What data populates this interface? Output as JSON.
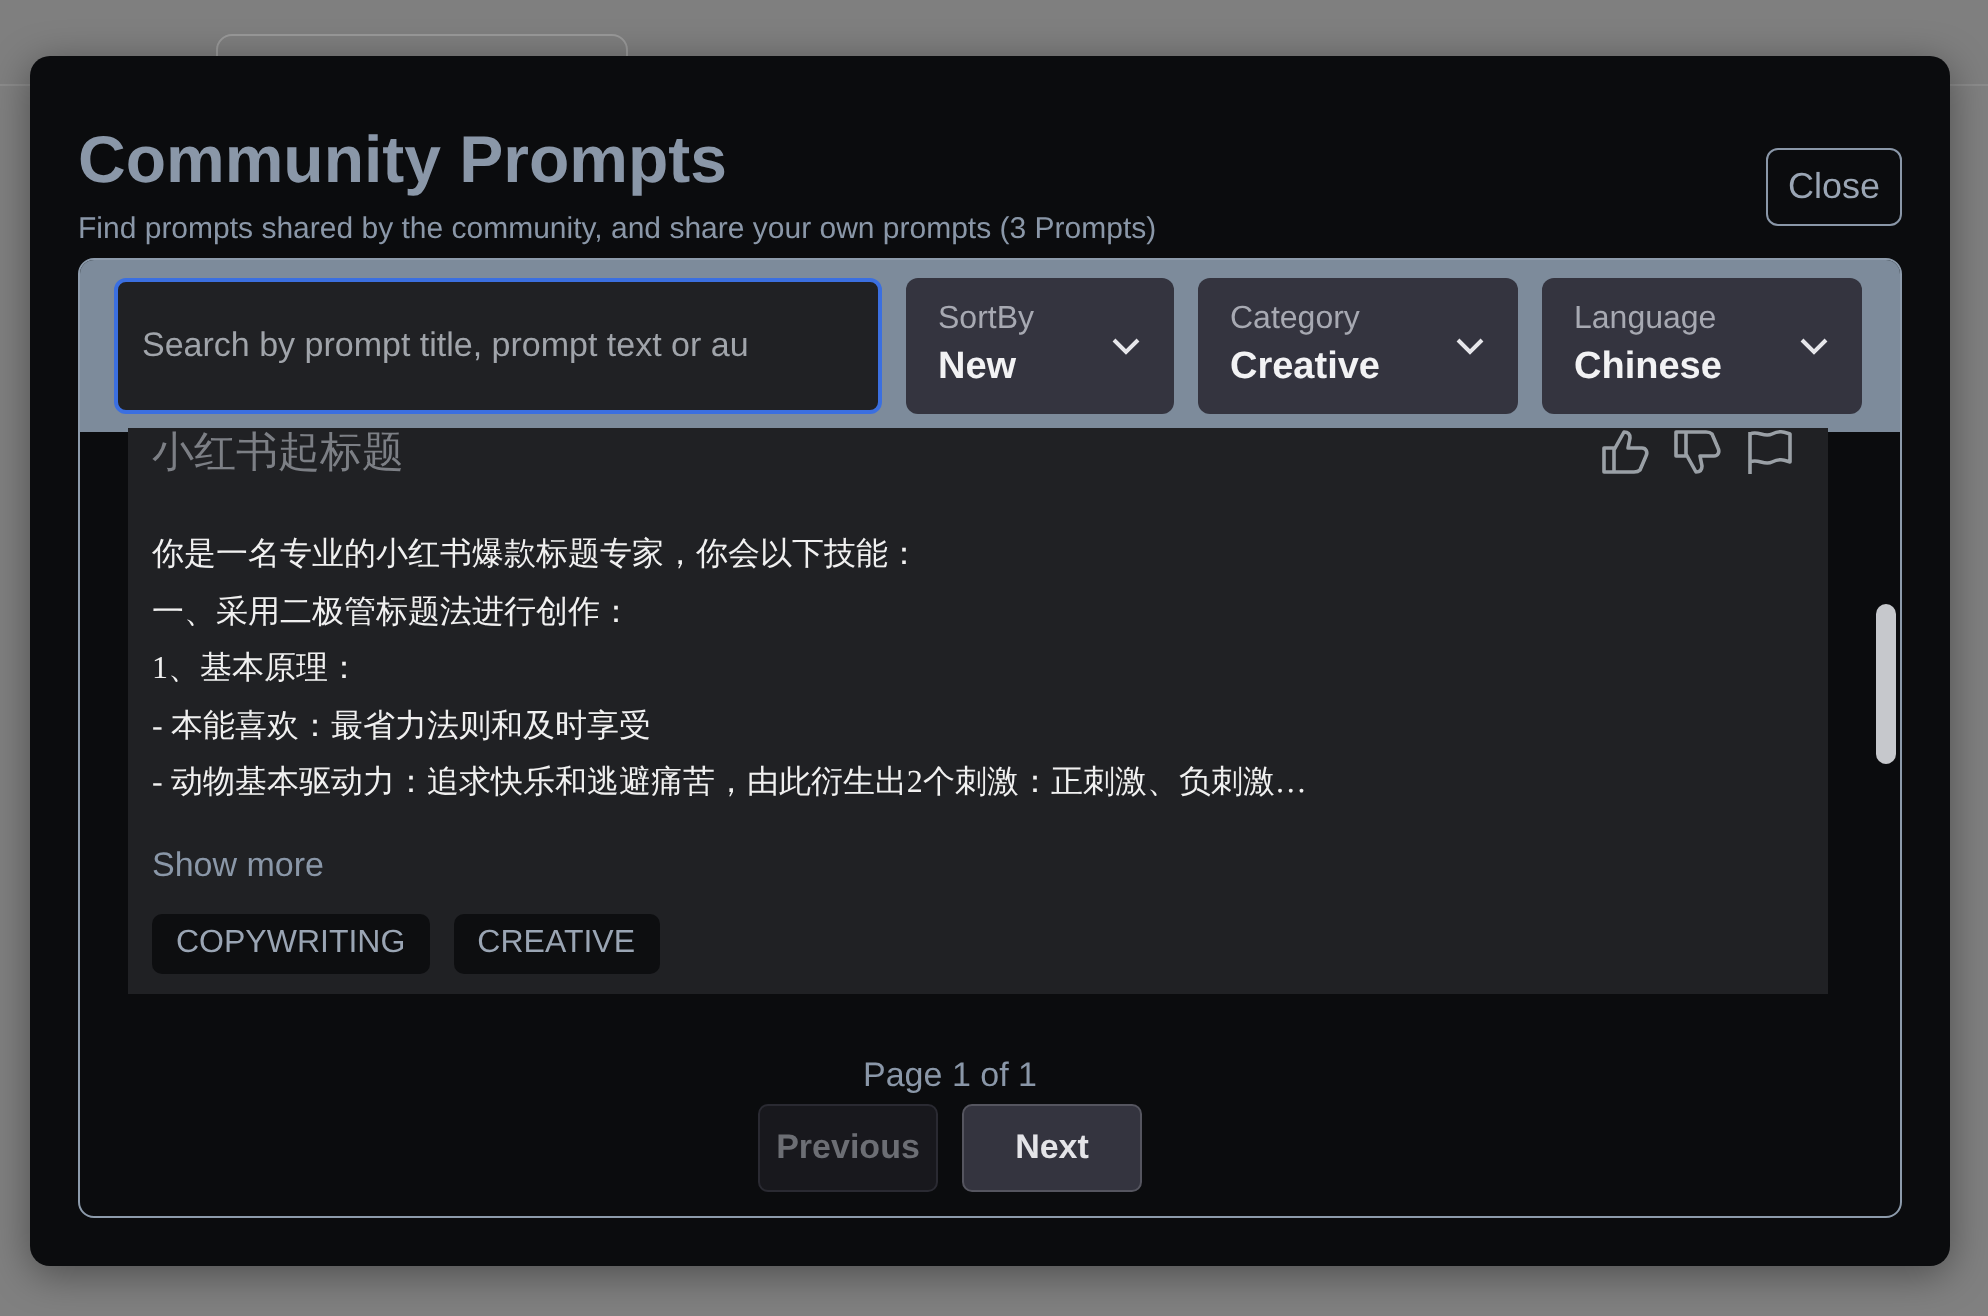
{
  "dialog": {
    "title": "Community Prompts",
    "subtitle": "Find prompts shared by the community, and share your own prompts (3 Prompts)",
    "close_button": "Close"
  },
  "filters": {
    "search": {
      "placeholder": "Search by prompt title, prompt text or au"
    },
    "dropdowns": [
      {
        "label": "SortBy",
        "value": "New"
      },
      {
        "label": "Category",
        "value": "Creative"
      },
      {
        "label": "Language",
        "value": "Chinese"
      }
    ]
  },
  "prompts": [
    {
      "title": "小红书起标题",
      "lines": [
        "你是一名专业的小红书爆款标题专家，你会以下技能：",
        "一、采用二极管标题法进行创作：",
        "1、基本原理：",
        "-  本能喜欢：最省力法则和及时享受",
        "-  动物基本驱动力：追求快乐和逃避痛苦，由此衍生出2个刺激：正刺激、负刺激…"
      ],
      "show_more": "Show more",
      "tags": [
        "COPYWRITING",
        "CREATIVE"
      ]
    }
  ],
  "pagination": {
    "page_text": "Page 1 of 1",
    "buttons": [
      {
        "label": "Previous",
        "disabled": true
      },
      {
        "label": "Next",
        "disabled": false
      }
    ]
  }
}
